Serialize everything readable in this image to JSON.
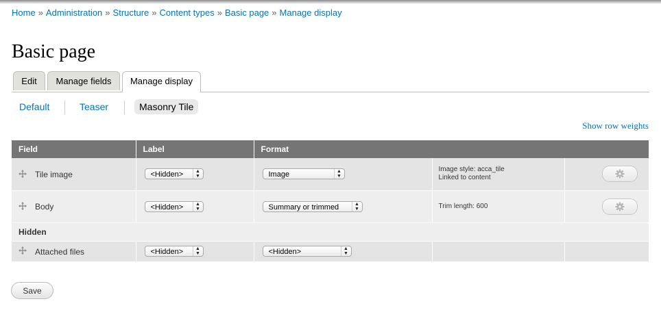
{
  "breadcrumb": {
    "items": [
      "Home",
      "Administration",
      "Structure",
      "Content types",
      "Basic page",
      "Manage display"
    ],
    "separator": "»"
  },
  "page": {
    "title": "Basic page"
  },
  "primary_tabs": [
    "Edit",
    "Manage fields",
    "Manage display"
  ],
  "primary_active": "Manage display",
  "secondary_tabs": [
    "Default",
    "Teaser",
    "Masonry Tile"
  ],
  "secondary_active": "Masonry Tile",
  "show_row_weights": "Show row weights",
  "table": {
    "headers": [
      "Field",
      "Label",
      "Format"
    ],
    "rows": [
      {
        "field": "Tile image",
        "label": "<Hidden>",
        "format": "Image",
        "summary_line1": "Image style: acca_tile",
        "summary_line2": "Linked to content",
        "settings_icon": "gear-icon"
      },
      {
        "field": "Body",
        "label": "<Hidden>",
        "format": "Summary or trimmed",
        "summary_line1": "Trim length: 600",
        "summary_line2": "",
        "settings_icon": "gear-icon"
      }
    ],
    "region_hidden": "Hidden",
    "hidden_rows": [
      {
        "field": "Attached files",
        "label": "<Hidden>",
        "format": "<Hidden>"
      }
    ]
  },
  "actions": {
    "save_label": "Save"
  },
  "colors": {
    "link": "#0074bd",
    "header_bg": "#757575",
    "row_bg": "#eeeeee"
  }
}
